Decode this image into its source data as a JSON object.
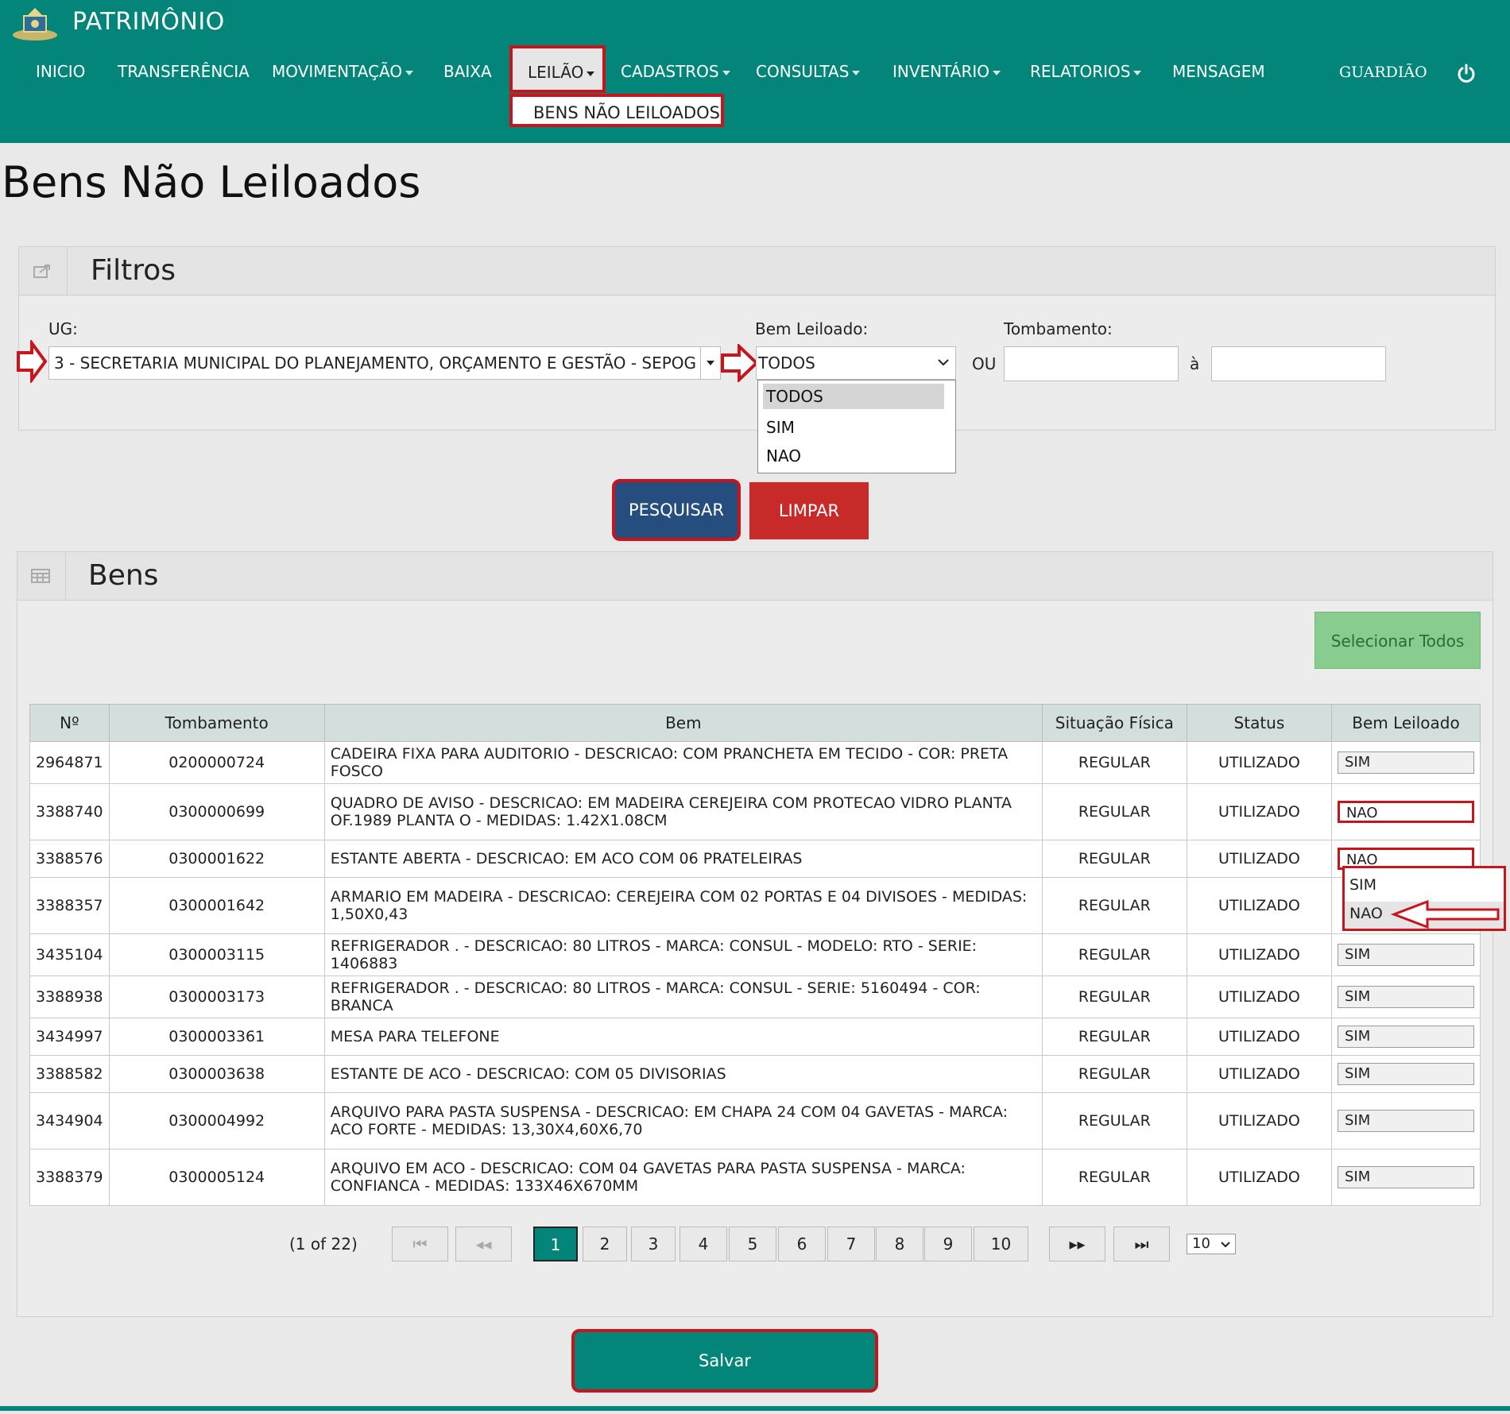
{
  "header": {
    "app_title": "PATRIMÔNIO",
    "nav": [
      {
        "label": "INICIO"
      },
      {
        "label": "TRANSFERÊNCIA"
      },
      {
        "label": "MOVIMENTAÇÃO"
      },
      {
        "label": "BAIXA"
      },
      {
        "label": "LEILÃO"
      },
      {
        "label": "CADASTROS"
      },
      {
        "label": "CONSULTAS"
      },
      {
        "label": "INVENTÁRIO"
      },
      {
        "label": "RELATORIOS"
      },
      {
        "label": "MENSAGEM"
      }
    ],
    "submenu_item": "BENS NÃO LEILOADOS",
    "user": "GUARDIÃO"
  },
  "page_title": "Bens Não Leiloados",
  "filters": {
    "title": "Filtros",
    "ug_label": "UG:",
    "ug_value": "3 - SECRETARIA MUNICIPAL DO PLANEJAMENTO, ORÇAMENTO E GESTÃO - SEPOG",
    "bem_leiloado_label": "Bem Leiloado:",
    "bem_leiloado_value": "TODOS",
    "bem_leiloado_options": [
      "TODOS",
      "SIM",
      "NAO"
    ],
    "tombamento_label": "Tombamento:",
    "ou": "OU",
    "a": "à",
    "pesquisar": "PESQUISAR",
    "limpar": "LIMPAR"
  },
  "bens": {
    "title": "Bens",
    "select_all": "Selecionar Todos",
    "headers": [
      "Nº",
      "Tombamento",
      "Bem",
      "Situação Física",
      "Status",
      "Bem Leiloado"
    ],
    "rows": [
      {
        "n": "2964871",
        "tomb": "0200000724",
        "bem": "CADEIRA FIXA PARA AUDITORIO - DESCRICAO: COM PRANCHETA EM TECIDO - COR: PRETA FOSCO",
        "sit": "REGULAR",
        "status": "UTILIZADO",
        "leiloado": "SIM"
      },
      {
        "n": "3388740",
        "tomb": "0300000699",
        "bem": "QUADRO DE AVISO - DESCRICAO: EM MADEIRA CEREJEIRA COM PROTECAO VIDRO PLANTA OF.1989 PLANTA O - MEDIDAS: 1.42X1.08CM",
        "sit": "REGULAR",
        "status": "UTILIZADO",
        "leiloado": "NAO"
      },
      {
        "n": "3388576",
        "tomb": "0300001622",
        "bem": "ESTANTE ABERTA - DESCRICAO: EM ACO COM 06 PRATELEIRAS",
        "sit": "REGULAR",
        "status": "UTILIZADO",
        "leiloado": "NAO"
      },
      {
        "n": "3388357",
        "tomb": "0300001642",
        "bem": "ARMARIO EM MADEIRA - DESCRICAO: CEREJEIRA COM 02 PORTAS E 04 DIVISOES - MEDIDAS: 1,50X0,43",
        "sit": "REGULAR",
        "status": "UTILIZADO",
        "leiloado": ""
      },
      {
        "n": "3435104",
        "tomb": "0300003115",
        "bem": "REFRIGERADOR . - DESCRICAO: 80 LITROS - MARCA: CONSUL - MODELO: RTO - SERIE: 1406883",
        "sit": "REGULAR",
        "status": "UTILIZADO",
        "leiloado": "SIM"
      },
      {
        "n": "3388938",
        "tomb": "0300003173",
        "bem": "REFRIGERADOR . - DESCRICAO: 80 LITROS - MARCA: CONSUL - SERIE: 5160494 - COR: BRANCA",
        "sit": "REGULAR",
        "status": "UTILIZADO",
        "leiloado": "SIM"
      },
      {
        "n": "3434997",
        "tomb": "0300003361",
        "bem": "MESA PARA TELEFONE",
        "sit": "REGULAR",
        "status": "UTILIZADO",
        "leiloado": "SIM"
      },
      {
        "n": "3388582",
        "tomb": "0300003638",
        "bem": "ESTANTE DE ACO - DESCRICAO: COM 05 DIVISORIAS",
        "sit": "REGULAR",
        "status": "UTILIZADO",
        "leiloado": "SIM"
      },
      {
        "n": "3434904",
        "tomb": "0300004992",
        "bem": "ARQUIVO PARA PASTA SUSPENSA - DESCRICAO: EM CHAPA 24 COM 04 GAVETAS - MARCA: ACO FORTE - MEDIDAS: 13,30X4,60X6,70",
        "sit": "REGULAR",
        "status": "UTILIZADO",
        "leiloado": "SIM"
      },
      {
        "n": "3388379",
        "tomb": "0300005124",
        "bem": "ARQUIVO EM ACO - DESCRICAO: COM 04 GAVETAS PARA PASTA SUSPENSA - MARCA: CONFIANCA - MEDIDAS: 133X46X670MM",
        "sit": "REGULAR",
        "status": "UTILIZADO",
        "leiloado": "SIM"
      }
    ],
    "row_dropdown_options": [
      "SIM",
      "NAO"
    ]
  },
  "pager": {
    "summary": "(1 of 22)",
    "pages": [
      "1",
      "2",
      "3",
      "4",
      "5",
      "6",
      "7",
      "8",
      "9",
      "10"
    ],
    "first": "⏮",
    "prev": "◂◂",
    "next": "▸▸",
    "last": "⏭",
    "per_page": "10"
  },
  "save": "Salvar",
  "colors": {
    "teal": "#03857a",
    "red_highlight": "#c8151d",
    "pesquisar_blue": "#254e7e",
    "limpar_red": "#c82a2a",
    "select_all_green": "#88cc8f"
  }
}
